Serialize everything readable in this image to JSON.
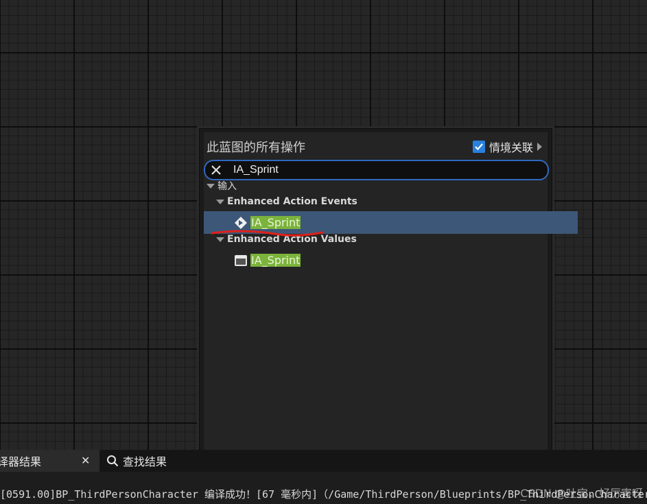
{
  "popup": {
    "title": "此蓝图的所有操作",
    "context_toggle": {
      "label": "情境关联",
      "checked": true
    },
    "search": {
      "value": "IA_Sprint",
      "placeholder": ""
    },
    "tree": [
      {
        "label": "输入"
      },
      {
        "label": "Enhanced Action Events"
      },
      {
        "label": "IA_Sprint",
        "selected": true
      },
      {
        "label": "Enhanced Action Values"
      },
      {
        "label": "IA_Sprint"
      }
    ]
  },
  "bottom_tabs": {
    "compiler": "译器结果",
    "find": "查找结果"
  },
  "status": {
    "log": "[0591.00]BP_ThirdPersonCharacter 编译成功！[67 毫秒内]（/Game/ThirdPerson/Blueprints/BP_ThirdPersonCharacter",
    "watermark": "CSDN @吐宝，好厉害呀"
  },
  "colors": {
    "search_border": "#2f6ac0",
    "selection": "#3d5778",
    "highlight": "#7bb33b",
    "checkbox": "#2a80dd",
    "annotation_stroke": "#e0201a"
  }
}
